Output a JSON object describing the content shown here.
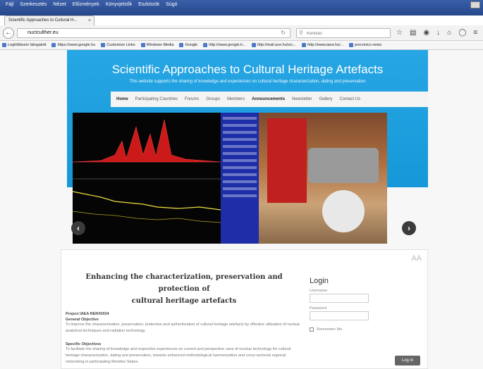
{
  "browser": {
    "menu": [
      "Fájl",
      "Szerkesztés",
      "Nézet",
      "Előzmények",
      "Könyvjelzők",
      "Eszközök",
      "Súgó"
    ],
    "tab_title": "Scientific Approaches to Cultural H...",
    "tab_close": "×",
    "new_tab": "+",
    "url": "nuctculther.eu",
    "search_placeholder": "Keresés",
    "bookmarks": [
      "Legtöbbször látogatott",
      "https://www.google.hu",
      "Customize Links",
      "Windows Media",
      "Google",
      "http://www.google.h...",
      "http://mail.ace.hu/src...",
      "http://www.iaea.hu/...",
      "preconics news"
    ]
  },
  "site": {
    "title": "Scientific Approaches to Cultural Heritage Artefacts",
    "subtitle": "This website supports the sharing of knowledge and experiences on cultural heritage characterization, dating and preservation",
    "menu": [
      {
        "label": "Home",
        "bold": true
      },
      {
        "label": "Participating Countries",
        "bold": false
      },
      {
        "label": "Forums",
        "bold": false
      },
      {
        "label": "Groups",
        "bold": false
      },
      {
        "label": "Members",
        "bold": false
      },
      {
        "label": "Announcements",
        "bold": true
      },
      {
        "label": "Newsletter",
        "bold": false
      },
      {
        "label": "Gallery",
        "bold": false
      },
      {
        "label": "Contact Us",
        "bold": false
      }
    ]
  },
  "slider": {
    "prev": "‹",
    "next": "›",
    "dot_count": 5,
    "active_dot": 4
  },
  "article": {
    "title_line1": "Enhancing the characterization, preservation and protection of",
    "title_line2": "cultural heritage artefacts",
    "project": "Project IAEA RER/0/034",
    "general_heading": "General Objective",
    "general_text": "To improve the characterisation, preservation, protection and authentication of cultural heritage artefacts by effective utilisation of nuclear analytical techniques and radiation technology.",
    "specific_heading": "Specific Objectives",
    "specific_text": "To facilitate the sharing of knowledge and respective experiences on current and perspective uses of nuclear technology for cultural heritage characterization, dating and preservation, towards enhanced methodological harmonization and cross-sectorial regional networking in participating Member States."
  },
  "login": {
    "title": "Login",
    "username_label": "Username",
    "password_label": "Password",
    "remember_label": "Remember Me",
    "button": "Log in"
  }
}
